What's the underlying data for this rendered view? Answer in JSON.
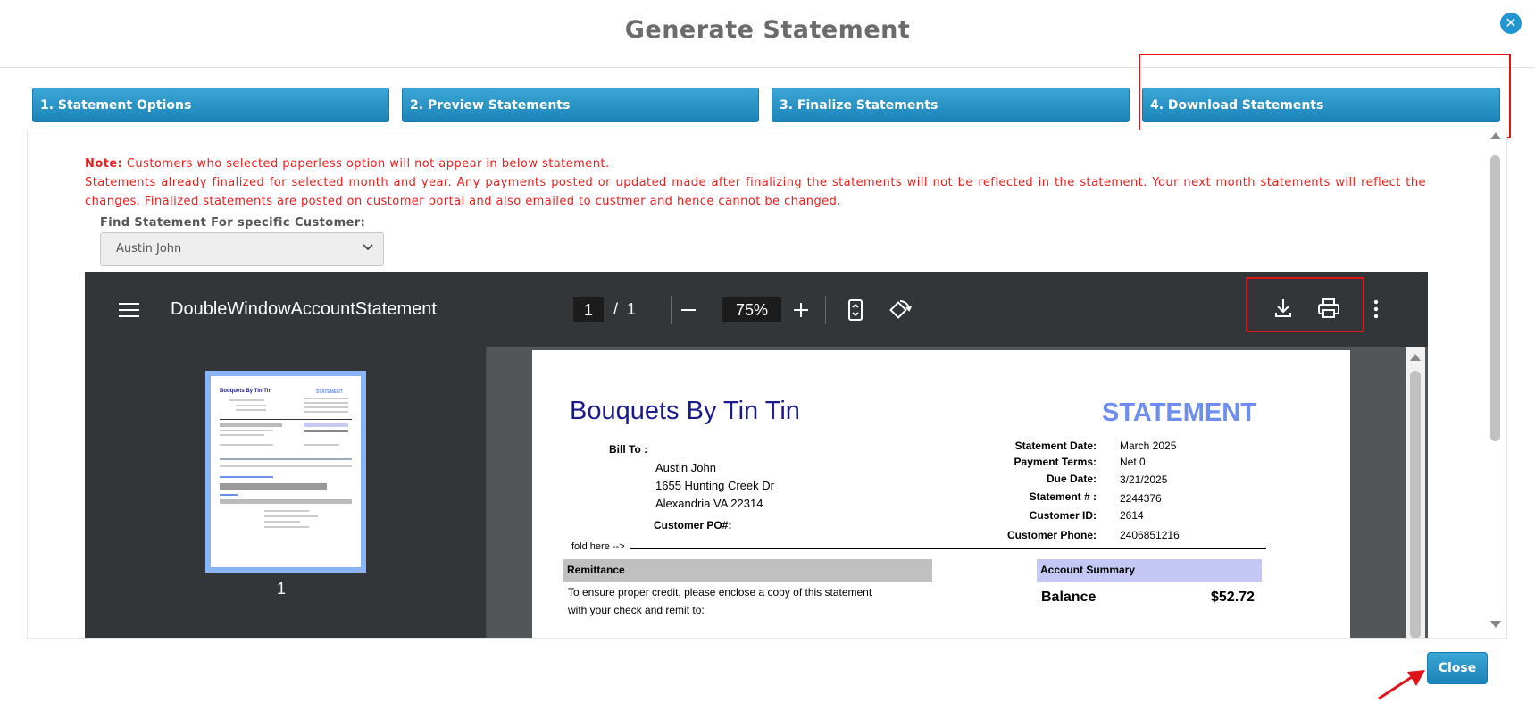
{
  "modal": {
    "title": "Generate Statement",
    "close_icon": "close-circle-icon"
  },
  "steps": [
    {
      "label": "1. Statement Options"
    },
    {
      "label": "2. Preview Statements"
    },
    {
      "label": "3. Finalize Statements"
    },
    {
      "label": "4. Download Statements"
    }
  ],
  "note": {
    "prefix": "Note:",
    "line1": " Customers who selected paperless option will not appear in below statement.",
    "line2": "Statements already finalized for selected month and year. Any payments posted or updated made after finalizing the statements will not be reflected in the statement. Your next month statements will reflect the changes. Finalized statements are posted on customer portal and also emailed to custmer and hence cannot be changed."
  },
  "customer_filter": {
    "label": "Find Statement For specific Customer:",
    "selected": "Austin John"
  },
  "pdf_viewer": {
    "title": "DoubleWindowAccountStatement",
    "current_page": "1",
    "separator": "/",
    "total_pages": "1",
    "zoom": "75%",
    "thumbnail_page": "1",
    "icons": [
      "menu-icon",
      "zoom-out-icon",
      "zoom-in-icon",
      "fit-page-icon",
      "rotate-icon",
      "download-icon",
      "print-icon",
      "more-vert-icon"
    ]
  },
  "statement": {
    "company": "Bouquets By Tin Tin",
    "heading": "STATEMENT",
    "bill_to_label": "Bill To :",
    "bill_to": [
      "Austin John",
      "1655 Hunting Creek Dr",
      "Alexandria VA 22314"
    ],
    "customer_po_label": "Customer PO#:",
    "fields": [
      {
        "label": "Statement Date:",
        "value": "March 2025"
      },
      {
        "label": "Payment Terms:",
        "value": "Net 0"
      },
      {
        "label": "Due Date:",
        "value": "3/21/2025"
      },
      {
        "label": "Statement # :",
        "value": "2244376"
      },
      {
        "label": "Customer ID:",
        "value": "2614"
      },
      {
        "label": "Customer Phone:",
        "value": "2406851216"
      }
    ],
    "fold_here": "fold here -->",
    "remittance_label": "Remittance",
    "remittance_text1": "To ensure proper credit, please enclose a copy of this statement",
    "remittance_text2": "with your check and remit to:",
    "account_summary_label": "Account Summary",
    "balance_label": "Balance",
    "balance_value": "$52.72"
  },
  "footer": {
    "close_label": "Close"
  },
  "colors": {
    "accent": "#2196d3",
    "note_red": "#ee1c1c",
    "highlight_red": "#e0141b",
    "company_blue": "#1a1a8c",
    "statement_blue": "#6d8ef0"
  }
}
